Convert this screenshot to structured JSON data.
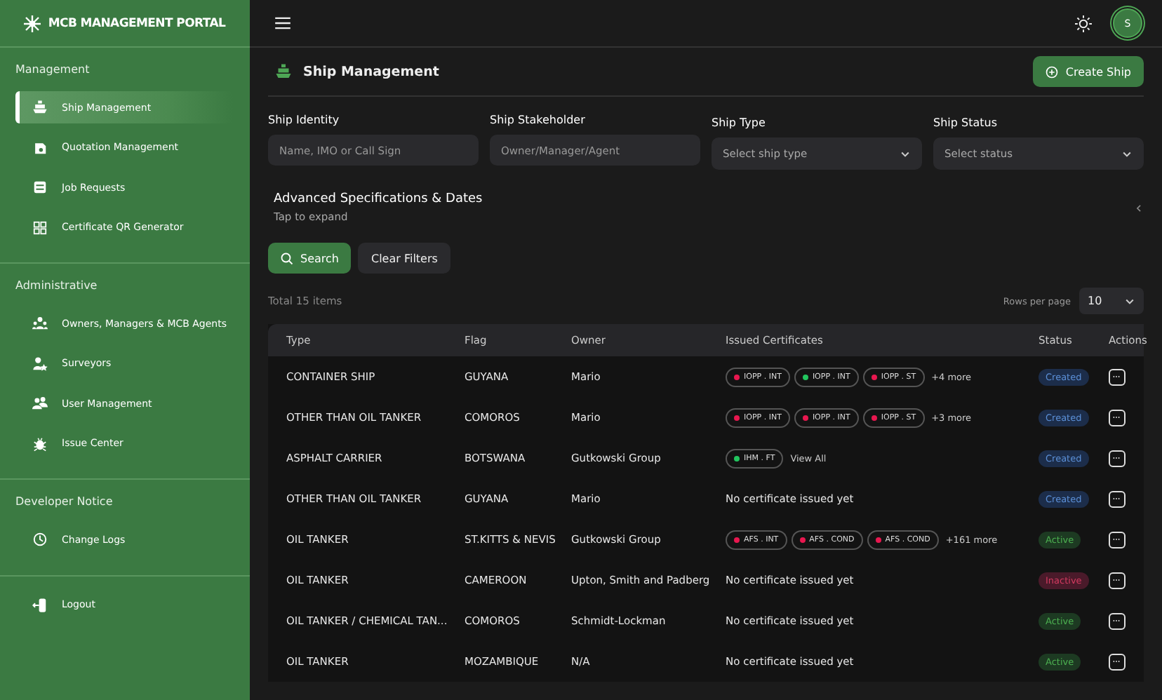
{
  "sidebar": {
    "logo": "MCB MANAGEMENT PORTAL",
    "sections": [
      {
        "title": "Management",
        "items": [
          {
            "label": "Ship Management",
            "selected": true
          },
          {
            "label": "Quotation Management",
            "selected": false
          },
          {
            "label": "Job Requests",
            "selected": false
          },
          {
            "label": "Certificate QR Generator",
            "selected": false
          }
        ]
      },
      {
        "title": "Administrative",
        "items": [
          {
            "label": "Owners, Managers & MCB Agents",
            "selected": false
          },
          {
            "label": "Surveyors",
            "selected": false
          },
          {
            "label": "User Management",
            "selected": false
          },
          {
            "label": "Issue Center",
            "selected": false
          }
        ]
      },
      {
        "title": "Developer Notice",
        "items": [
          {
            "label": "Change Logs",
            "selected": false
          }
        ]
      },
      {
        "items": [
          {
            "label": "Logout",
            "selected": false
          }
        ]
      }
    ]
  },
  "topbar": {
    "avatar": "S"
  },
  "page": {
    "title": "Ship Management",
    "create_button": "Create Ship"
  },
  "filters": [
    {
      "label": "Ship Identity",
      "kind": "text",
      "placeholder": "Name, IMO or Call Sign"
    },
    {
      "label": "Ship Stakeholder",
      "kind": "text",
      "placeholder": "Owner/Manager/Agent"
    },
    {
      "label": "Ship Type",
      "kind": "select",
      "placeholder": "Select ship type"
    },
    {
      "label": "Ship Status",
      "kind": "select",
      "placeholder": "Select status"
    }
  ],
  "advanced": {
    "title": "Advanced Specifications & Dates",
    "hint": "Tap to expand",
    "expanded": false
  },
  "buttons": {
    "search": "Search",
    "clear": "Clear Filters"
  },
  "summary": {
    "total": "Total 15 items",
    "rows_per_page_label": "Rows per page",
    "rows_per_page": "10"
  },
  "table": {
    "columns": [
      "Type",
      "Flag",
      "Owner",
      "Issued Certificates",
      "Status",
      "Actions"
    ],
    "rows": [
      {
        "type": "CONTAINER SHIP",
        "flag": "GUYANA",
        "owner": "Mario",
        "certificates": [
          {
            "label": "IOPP . INT",
            "color": "#e8174f"
          },
          {
            "label": "IOPP . INT",
            "color": "#22c55e"
          },
          {
            "label": "IOPP . ST",
            "color": "#e8174f"
          }
        ],
        "more": "+4 more",
        "status": {
          "label": "Created",
          "kind": "created"
        }
      },
      {
        "type": "OTHER THAN OIL TANKER",
        "flag": "COMOROS",
        "owner": "Mario",
        "certificates": [
          {
            "label": "IOPP . INT",
            "color": "#e8174f"
          },
          {
            "label": "IOPP . INT",
            "color": "#e8174f"
          },
          {
            "label": "IOPP . ST",
            "color": "#e8174f"
          }
        ],
        "more": "+3 more",
        "status": {
          "label": "Created",
          "kind": "created"
        }
      },
      {
        "type": "ASPHALT CARRIER",
        "flag": "BOTSWANA",
        "owner": "Gutkowski Group",
        "certificates": [
          {
            "label": "IHM . FT",
            "color": "#22c55e"
          }
        ],
        "view_all": "View All",
        "status": {
          "label": "Created",
          "kind": "created"
        }
      },
      {
        "type": "OTHER THAN OIL TANKER",
        "flag": "GUYANA",
        "owner": "Mario",
        "empty": "No certificate issued yet",
        "status": {
          "label": "Created",
          "kind": "created"
        }
      },
      {
        "type": "OIL TANKER",
        "flag": "ST.KITTS & NEVIS",
        "owner": "Gutkowski Group",
        "certificates": [
          {
            "label": "AFS . INT",
            "color": "#e8174f"
          },
          {
            "label": "AFS . COND",
            "color": "#e8174f"
          },
          {
            "label": "AFS . COND",
            "color": "#e8174f"
          }
        ],
        "more": "+161 more",
        "status": {
          "label": "Active",
          "kind": "active"
        }
      },
      {
        "type": "OIL TANKER",
        "flag": "CAMEROON",
        "owner": "Upton, Smith and Padberg",
        "empty": "No certificate issued yet",
        "status": {
          "label": "Inactive",
          "kind": "inactive"
        }
      },
      {
        "type": "OIL TANKER / CHEMICAL TAN...",
        "flag": "COMOROS",
        "owner": "Schmidt-Lockman",
        "empty": "No certificate issued yet",
        "status": {
          "label": "Active",
          "kind": "active"
        }
      },
      {
        "type": "OIL TANKER",
        "flag": "MOZAMBIQUE",
        "owner": "N/A",
        "empty": "No certificate issued yet",
        "status": {
          "label": "Active",
          "kind": "active"
        }
      }
    ]
  }
}
